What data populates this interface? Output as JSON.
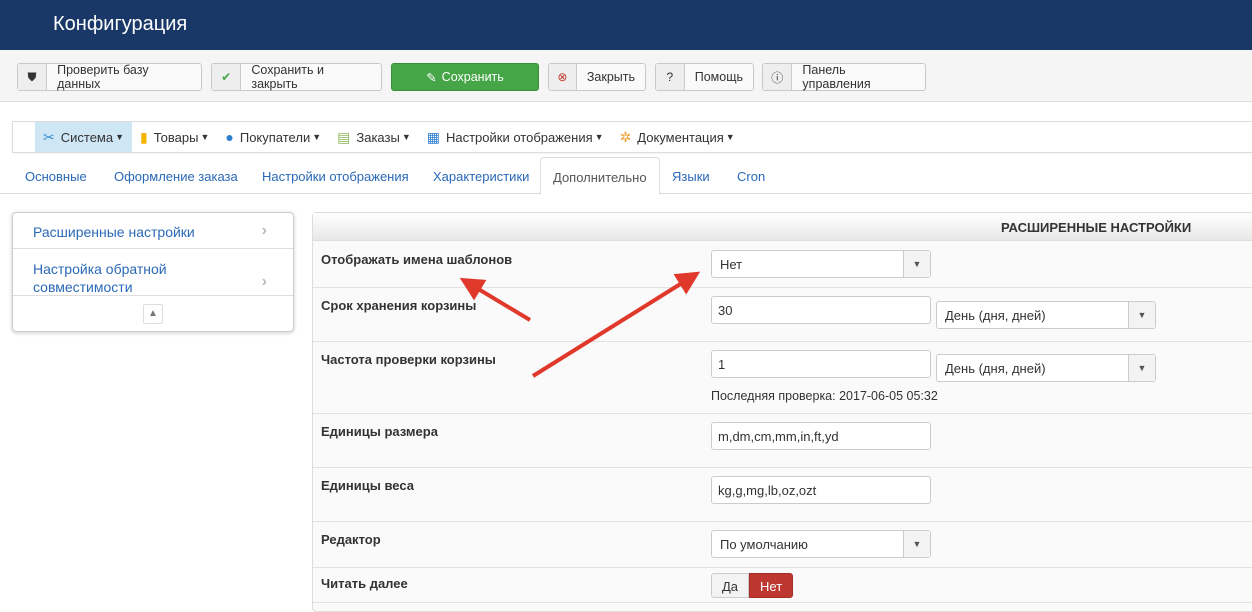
{
  "header": {
    "title": "Конфигурация"
  },
  "toolbar": [
    {
      "label": "Проверить базу данных",
      "icon": "shield-icon"
    },
    {
      "label": "Сохранить и закрыть",
      "icon": "check-icon"
    },
    {
      "label": "Сохранить",
      "icon": "edit-icon"
    },
    {
      "label": "Закрыть",
      "icon": "close-circle-icon"
    },
    {
      "label": "Помощь",
      "icon": "question-icon"
    },
    {
      "label": "Панель управления",
      "icon": "info-icon"
    }
  ],
  "menu": [
    {
      "label": "Система"
    },
    {
      "label": "Товары"
    },
    {
      "label": "Покупатели"
    },
    {
      "label": "Заказы"
    },
    {
      "label": "Настройки отображения"
    },
    {
      "label": "Документация"
    }
  ],
  "tabs": [
    "Основные",
    "Оформление заказа",
    "Настройки отображения",
    "Характеристики",
    "Дополнительно",
    "Языки",
    "Cron"
  ],
  "sidebar": {
    "items": [
      "Расширенные настройки",
      "Настройка обратной совместимости"
    ]
  },
  "panel": {
    "title": "РАСШИРЕННЫЕ НАСТРОЙКИ",
    "show_template_names": {
      "label": "Отображать имена шаблонов",
      "value": "Нет"
    },
    "cart_lifetime": {
      "label": "Срок хранения корзины",
      "value": "30",
      "unit": "День (дня, дней)"
    },
    "cart_check": {
      "label": "Частота проверки корзины",
      "value": "1",
      "unit": "День (дня, дней)",
      "last_check": "Последняя проверка: 2017-06-05 05:32"
    },
    "size_units": {
      "label": "Единицы размера",
      "value": "m,dm,cm,mm,in,ft,yd"
    },
    "weight_units": {
      "label": "Единицы веса",
      "value": "kg,g,mg,lb,oz,ozt"
    },
    "editor": {
      "label": "Редактор",
      "value": "По умолчанию"
    },
    "read_more": {
      "label": "Читать далее",
      "yes": "Да",
      "no": "Нет"
    }
  },
  "colors": {
    "header": "#1a3867",
    "save": "#46a546",
    "active_toggle": "#bd362f",
    "arrow": "#e0392b"
  }
}
